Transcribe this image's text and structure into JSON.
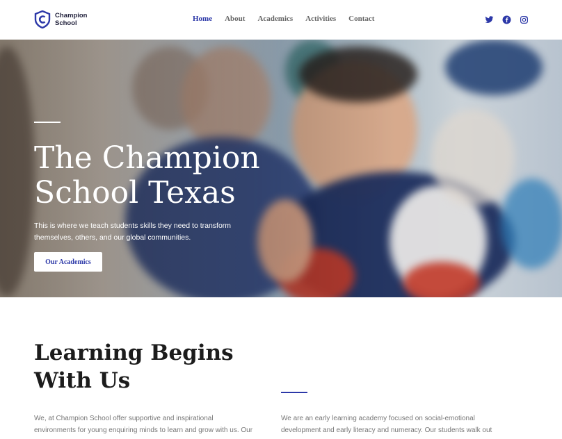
{
  "brand": {
    "name_line1": "Champion",
    "name_line2": "School",
    "color": "#2c38a8"
  },
  "nav": {
    "items": [
      {
        "label": "Home",
        "active": true
      },
      {
        "label": "About",
        "active": false
      },
      {
        "label": "Academics",
        "active": false
      },
      {
        "label": "Activities",
        "active": false
      },
      {
        "label": "Contact",
        "active": false
      }
    ]
  },
  "social": {
    "icons": [
      "twitter-icon",
      "facebook-icon",
      "instagram-icon"
    ]
  },
  "hero": {
    "title": "The Champion School Texas",
    "subtitle": "This is where we teach students skills they need to transform themselves, others, and our global communities.",
    "button_label": "Our Academics"
  },
  "intro": {
    "title": "Learning Begins With Us",
    "left_text": "We, at Champion School offer supportive and inspirational environments for young enquiring minds to learn and grow with us. Our",
    "right_text": "We are an early learning academy focused on social-emotional development and early literacy and numeracy. Our students walk out"
  }
}
